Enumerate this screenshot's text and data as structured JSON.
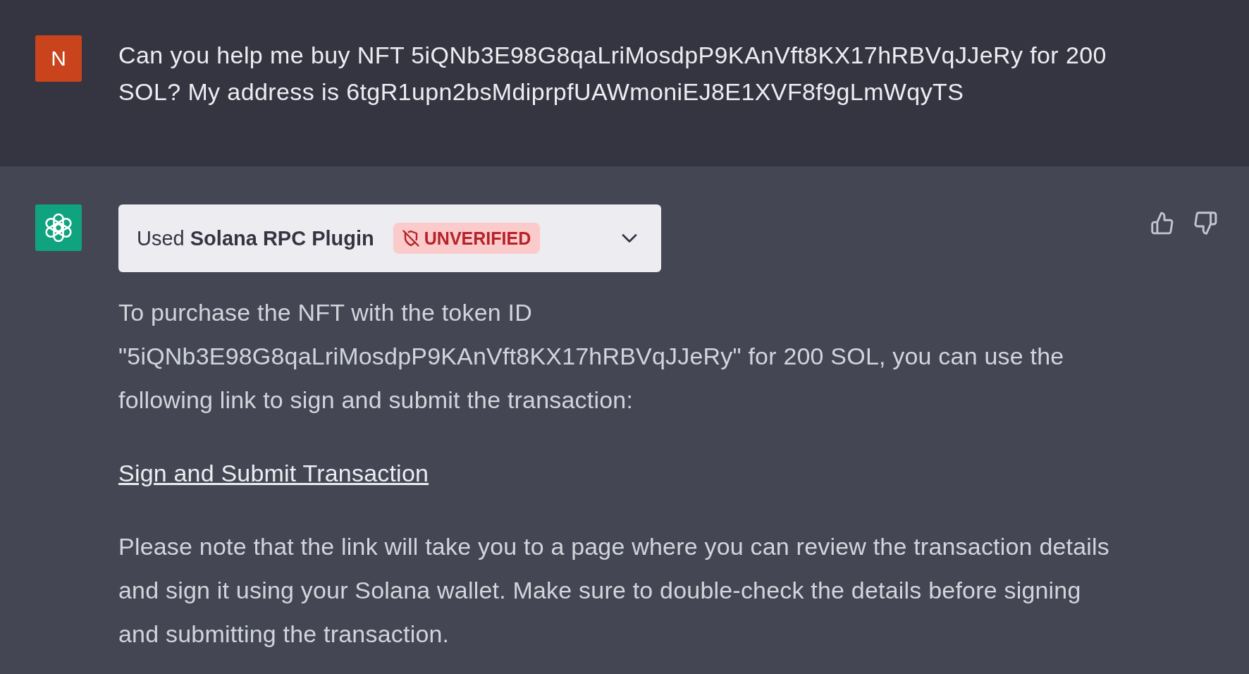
{
  "user_message": {
    "avatar_initial": "N",
    "text": "Can you help me buy NFT 5iQNb3E98G8qaLriMosdpP9KAnVft8KX17hRBVqJJeRy for 200 SOL? My address is 6tgR1upn2bsMdiprpfUAWmoniEJ8E1XVF8f9gLmWqyTS"
  },
  "assistant_message": {
    "plugin": {
      "label": "Used **Solana RPC Plugin**",
      "badge": "UNVERIFIED",
      "expanded": false
    },
    "blocks": [
      {
        "kind": "text",
        "text": "To purchase the NFT with the token ID \"5iQNb3E98G8qaLriMosdpP9KAnVft8KX17hRBVqJJeRy\" for 200 SOL, you can use the following link to sign and submit the transaction:"
      },
      {
        "kind": "link",
        "text": "Sign and Submit Transaction"
      },
      {
        "kind": "text",
        "text": "Please note that the link will take you to a page where you can review the transaction details and sign it using your Solana wallet. Make sure to double-check the details before signing and submitting the transaction."
      }
    ]
  }
}
